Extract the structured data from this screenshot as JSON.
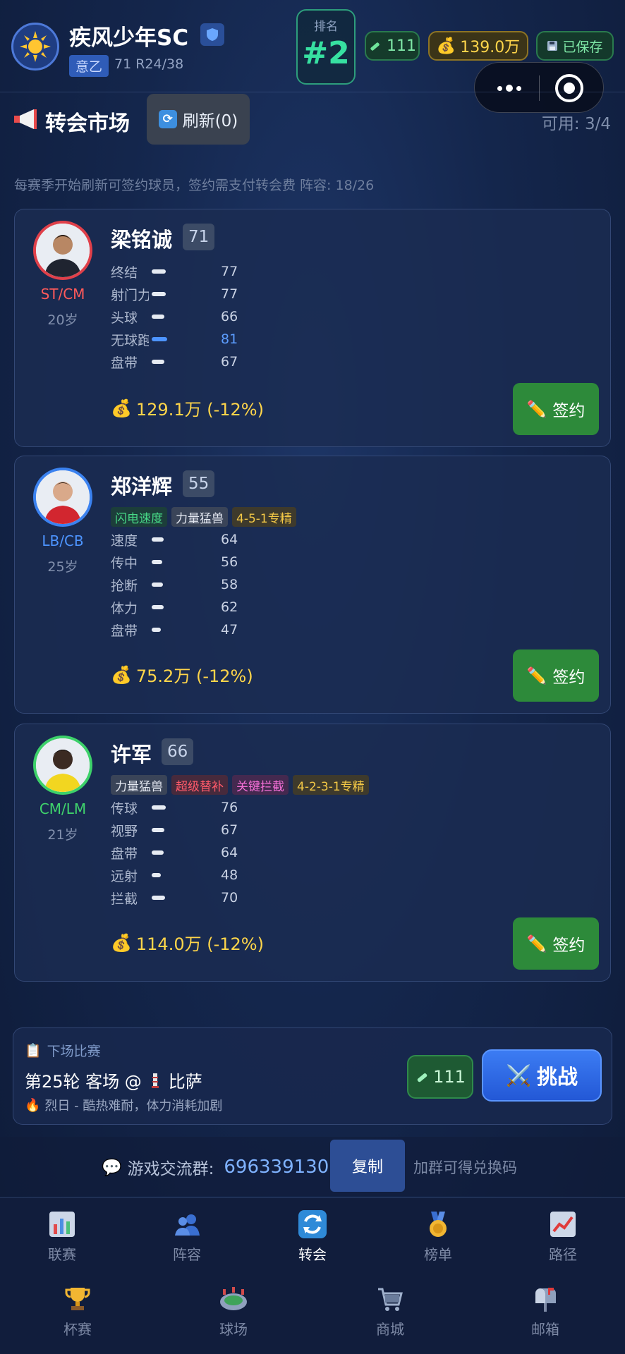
{
  "header": {
    "team_name": "疾风少年SC",
    "league": "意乙",
    "team_meta": "71 R24/38",
    "rank_label": "排名",
    "rank_value": "#2",
    "energy": "111",
    "coins": "139.0万",
    "saved_label": "已保存"
  },
  "market": {
    "title": "转会市场",
    "refresh_label": "刷新(0)",
    "available": "可用: 3/4",
    "note": "每赛季开始刷新可签约球员，签约需支付转会费  阵容: 18/26"
  },
  "players": [
    {
      "name": "梁铭诚",
      "rating": "71",
      "position": "ST/CM",
      "age": "20岁",
      "ring_color": "#e0404a",
      "pos_color": "#ff5a5a",
      "tags": [],
      "stats": [
        {
          "label": "终结",
          "value": 77
        },
        {
          "label": "射门力量",
          "value": 77
        },
        {
          "label": "头球",
          "value": 66
        },
        {
          "label": "无球跑动",
          "value": 81,
          "highlight": true
        },
        {
          "label": "盘带",
          "value": 67
        }
      ],
      "price": "129.1万 (-12%)",
      "sign_label": "签约"
    },
    {
      "name": "郑洋辉",
      "rating": "55",
      "position": "LB/CB",
      "age": "25岁",
      "ring_color": "#3b82f0",
      "pos_color": "#4d94ff",
      "tags": [
        {
          "label": "闪电速度",
          "style": "green"
        },
        {
          "label": "力量猛兽",
          "style": "white"
        },
        {
          "label": "4-5-1专精",
          "style": "gold"
        }
      ],
      "stats": [
        {
          "label": "速度",
          "value": 64
        },
        {
          "label": "传中",
          "value": 56
        },
        {
          "label": "抢断",
          "value": 58
        },
        {
          "label": "体力",
          "value": 62
        },
        {
          "label": "盘带",
          "value": 47
        }
      ],
      "price": "75.2万 (-12%)",
      "sign_label": "签约"
    },
    {
      "name": "许军",
      "rating": "66",
      "position": "CM/LM",
      "age": "21岁",
      "ring_color": "#3dd16a",
      "pos_color": "#3fd46c",
      "tags": [
        {
          "label": "力量猛兽",
          "style": "white"
        },
        {
          "label": "超级替补",
          "style": "red"
        },
        {
          "label": "关键拦截",
          "style": "pink"
        },
        {
          "label": "4-2-3-1专精",
          "style": "gold"
        }
      ],
      "stats": [
        {
          "label": "传球",
          "value": 76
        },
        {
          "label": "视野",
          "value": 67
        },
        {
          "label": "盘带",
          "value": 64
        },
        {
          "label": "远射",
          "value": 48
        },
        {
          "label": "拦截",
          "value": 70
        }
      ],
      "price": "114.0万 (-12%)",
      "sign_label": "签约"
    }
  ],
  "next_match": {
    "heading": "下场比赛",
    "round": "第25轮 客场 @",
    "opponent": "比萨",
    "weather": "烈日 - 酷热难耐，体力消耗加剧",
    "energy": "111",
    "challenge_label": "挑战"
  },
  "community": {
    "label": "游戏交流群:",
    "number": "696339130",
    "copy_label": "复制",
    "hint": "加群可得兑换码"
  },
  "nav": {
    "row1": [
      {
        "label": "联赛",
        "icon": "league-chart-icon"
      },
      {
        "label": "阵容",
        "icon": "squad-icon"
      },
      {
        "label": "转会",
        "icon": "transfer-icon",
        "active": true
      },
      {
        "label": "榜单",
        "icon": "medal-icon"
      },
      {
        "label": "路径",
        "icon": "trend-icon"
      }
    ],
    "row2": [
      {
        "label": "杯赛",
        "icon": "trophy-icon"
      },
      {
        "label": "球场",
        "icon": "stadium-icon"
      },
      {
        "label": "商城",
        "icon": "cart-icon"
      },
      {
        "label": "邮箱",
        "icon": "mailbox-icon"
      }
    ]
  }
}
